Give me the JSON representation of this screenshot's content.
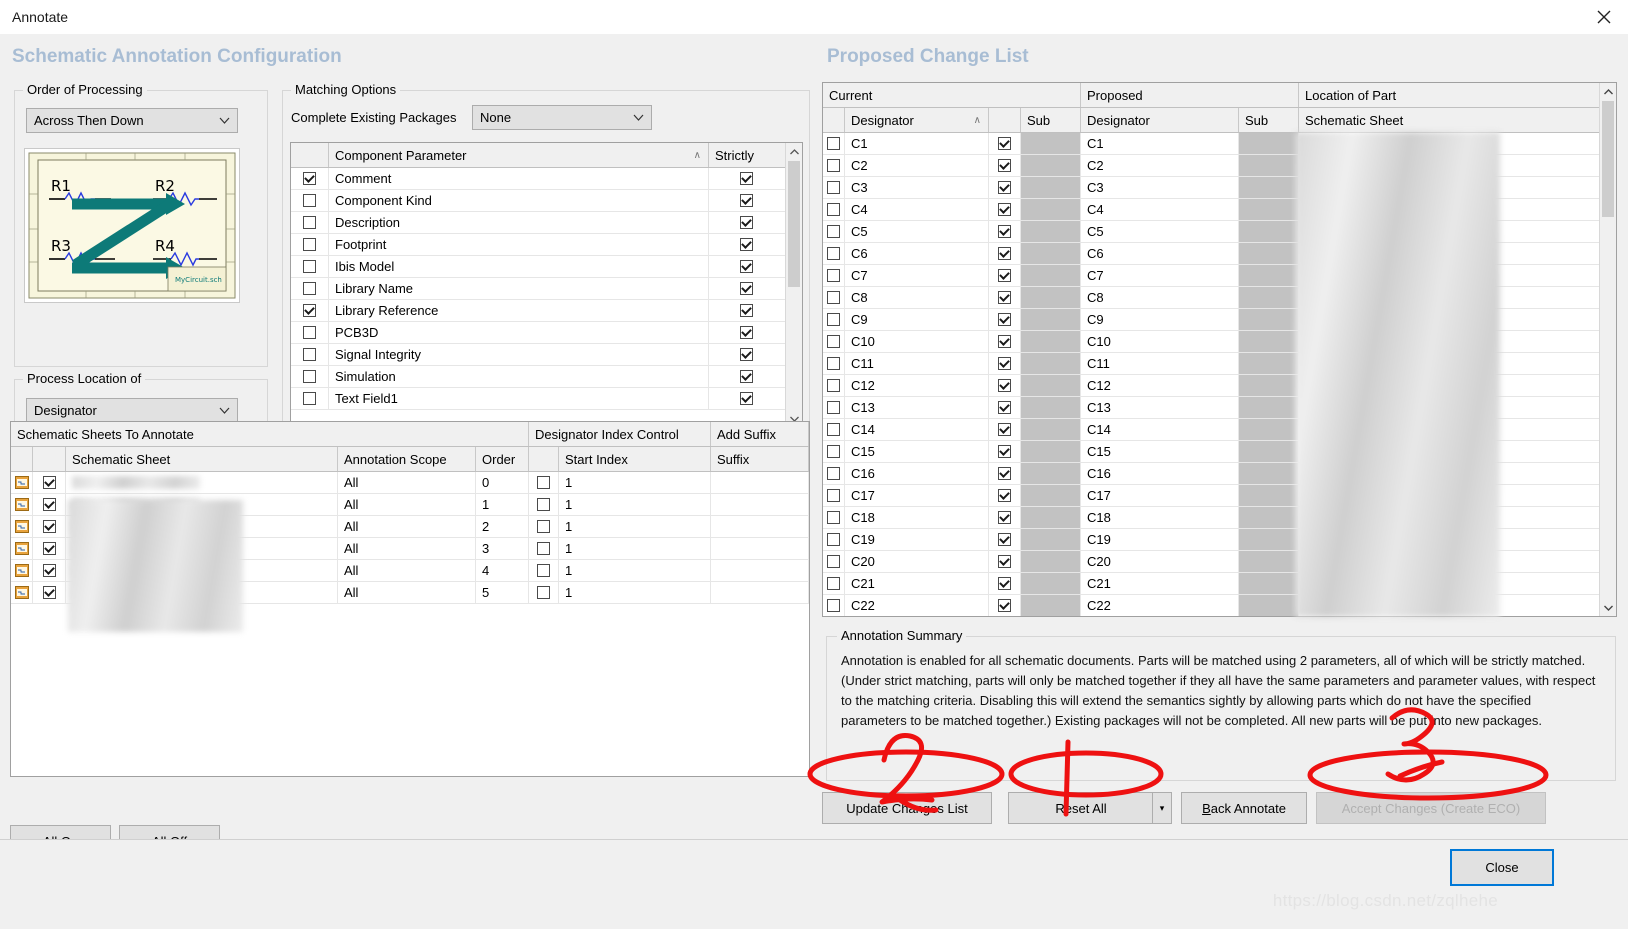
{
  "window": {
    "title": "Annotate",
    "close_icon": "close-icon"
  },
  "left": {
    "panel_title": "Schematic Annotation Configuration",
    "order_of_processing": {
      "legend": "Order of Processing",
      "value": "Across Then Down",
      "preview_labels": [
        "R1",
        "R2",
        "R3",
        "R4"
      ],
      "preview_caption": "MyCircuit.sch"
    },
    "process_location_of": {
      "legend": "Process Location of",
      "value": "Designator"
    },
    "matching_options": {
      "legend": "Matching Options",
      "complete_existing_packages_label": "Complete Existing Packages",
      "complete_existing_packages_value": "None",
      "columns": [
        "",
        "Component Parameter",
        "Strictly"
      ],
      "sort_indicator": "∧",
      "rows": [
        {
          "enabled": true,
          "parameter": "Comment",
          "strictly": true
        },
        {
          "enabled": false,
          "parameter": "Component Kind",
          "strictly": true
        },
        {
          "enabled": false,
          "parameter": "Description",
          "strictly": true
        },
        {
          "enabled": false,
          "parameter": "Footprint",
          "strictly": true
        },
        {
          "enabled": false,
          "parameter": "Ibis Model",
          "strictly": true
        },
        {
          "enabled": false,
          "parameter": "Library Name",
          "strictly": true
        },
        {
          "enabled": true,
          "parameter": "Library Reference",
          "strictly": true
        },
        {
          "enabled": false,
          "parameter": "PCB3D",
          "strictly": true
        },
        {
          "enabled": false,
          "parameter": "Signal Integrity",
          "strictly": true
        },
        {
          "enabled": false,
          "parameter": "Simulation",
          "strictly": true
        },
        {
          "enabled": false,
          "parameter": "Text Field1",
          "strictly": true
        }
      ]
    },
    "sheets_grid": {
      "group_headers": [
        "Schematic Sheets To Annotate",
        "Designator Index Control",
        "Add Suffix"
      ],
      "columns": [
        "",
        "",
        "Schematic Sheet",
        "Annotation Scope",
        "Order",
        "",
        "Start Index",
        "Suffix"
      ],
      "rows": [
        {
          "enabled": true,
          "sheet": "",
          "scope": "All",
          "order": "0",
          "index_enabled": false,
          "start_index": "1",
          "suffix": ""
        },
        {
          "enabled": true,
          "sheet": "",
          "scope": "All",
          "order": "1",
          "index_enabled": false,
          "start_index": "1",
          "suffix": ""
        },
        {
          "enabled": true,
          "sheet": "",
          "scope": "All",
          "order": "2",
          "index_enabled": false,
          "start_index": "1",
          "suffix": ""
        },
        {
          "enabled": true,
          "sheet": "",
          "scope": "All",
          "order": "3",
          "index_enabled": false,
          "start_index": "1",
          "suffix": ""
        },
        {
          "enabled": true,
          "sheet": "",
          "scope": "All",
          "order": "4",
          "index_enabled": false,
          "start_index": "1",
          "suffix": ""
        },
        {
          "enabled": true,
          "sheet": "",
          "scope": "All",
          "order": "5",
          "index_enabled": false,
          "start_index": "1",
          "suffix": ""
        }
      ]
    },
    "all_on_button": "All On",
    "all_on_mnemonic": "O",
    "all_off_button": "All Off",
    "all_off_mnemonic": "O"
  },
  "right": {
    "panel_title": "Proposed Change List",
    "group_headers": [
      "Current",
      "Proposed",
      "Location of Part"
    ],
    "columns": [
      "",
      "Designator",
      "",
      "Sub",
      "Designator",
      "Sub",
      "Schematic Sheet"
    ],
    "sort_indicator": "∧",
    "rows": [
      {
        "selected": false,
        "current": "C1",
        "accept": true,
        "current_sub": "",
        "proposed": "C1",
        "proposed_sub": "",
        "sheet": ""
      },
      {
        "selected": false,
        "current": "C2",
        "accept": true,
        "current_sub": "",
        "proposed": "C2",
        "proposed_sub": "",
        "sheet": ""
      },
      {
        "selected": false,
        "current": "C3",
        "accept": true,
        "current_sub": "",
        "proposed": "C3",
        "proposed_sub": "",
        "sheet": ""
      },
      {
        "selected": false,
        "current": "C4",
        "accept": true,
        "current_sub": "",
        "proposed": "C4",
        "proposed_sub": "",
        "sheet": ""
      },
      {
        "selected": false,
        "current": "C5",
        "accept": true,
        "current_sub": "",
        "proposed": "C5",
        "proposed_sub": "",
        "sheet": ""
      },
      {
        "selected": false,
        "current": "C6",
        "accept": true,
        "current_sub": "",
        "proposed": "C6",
        "proposed_sub": "",
        "sheet": ""
      },
      {
        "selected": false,
        "current": "C7",
        "accept": true,
        "current_sub": "",
        "proposed": "C7",
        "proposed_sub": "",
        "sheet": ""
      },
      {
        "selected": false,
        "current": "C8",
        "accept": true,
        "current_sub": "",
        "proposed": "C8",
        "proposed_sub": "",
        "sheet": ""
      },
      {
        "selected": false,
        "current": "C9",
        "accept": true,
        "current_sub": "",
        "proposed": "C9",
        "proposed_sub": "",
        "sheet": ""
      },
      {
        "selected": false,
        "current": "C10",
        "accept": true,
        "current_sub": "",
        "proposed": "C10",
        "proposed_sub": "",
        "sheet": ""
      },
      {
        "selected": false,
        "current": "C11",
        "accept": true,
        "current_sub": "",
        "proposed": "C11",
        "proposed_sub": "",
        "sheet": ""
      },
      {
        "selected": false,
        "current": "C12",
        "accept": true,
        "current_sub": "",
        "proposed": "C12",
        "proposed_sub": "",
        "sheet": ""
      },
      {
        "selected": false,
        "current": "C13",
        "accept": true,
        "current_sub": "",
        "proposed": "C13",
        "proposed_sub": "",
        "sheet": ""
      },
      {
        "selected": false,
        "current": "C14",
        "accept": true,
        "current_sub": "",
        "proposed": "C14",
        "proposed_sub": "",
        "sheet": ""
      },
      {
        "selected": false,
        "current": "C15",
        "accept": true,
        "current_sub": "",
        "proposed": "C15",
        "proposed_sub": "",
        "sheet": ""
      },
      {
        "selected": false,
        "current": "C16",
        "accept": true,
        "current_sub": "",
        "proposed": "C16",
        "proposed_sub": "",
        "sheet": ""
      },
      {
        "selected": false,
        "current": "C17",
        "accept": true,
        "current_sub": "",
        "proposed": "C17",
        "proposed_sub": "",
        "sheet": ""
      },
      {
        "selected": false,
        "current": "C18",
        "accept": true,
        "current_sub": "",
        "proposed": "C18",
        "proposed_sub": "",
        "sheet": ""
      },
      {
        "selected": false,
        "current": "C19",
        "accept": true,
        "current_sub": "",
        "proposed": "C19",
        "proposed_sub": "",
        "sheet": ""
      },
      {
        "selected": false,
        "current": "C20",
        "accept": true,
        "current_sub": "",
        "proposed": "C20",
        "proposed_sub": "",
        "sheet": ""
      },
      {
        "selected": false,
        "current": "C21",
        "accept": true,
        "current_sub": "",
        "proposed": "C21",
        "proposed_sub": "",
        "sheet": ""
      },
      {
        "selected": false,
        "current": "C22",
        "accept": true,
        "current_sub": "",
        "proposed": "C22",
        "proposed_sub": "",
        "sheet": ""
      }
    ],
    "summary": {
      "legend": "Annotation Summary",
      "text": "Annotation is enabled for all schematic documents. Parts will be matched using 2 parameters, all of which will be strictly matched. (Under strict matching, parts will only be matched together if they all have the same parameters and parameter values, with respect to the matching criteria. Disabling this will extend the semantics sightly by allowing parts which do not have the specified parameters to be matched together.) Existing packages will not be completed. All new parts will be put into new packages."
    },
    "buttons": {
      "update_changes_list": "Update Changes List",
      "reset_all": "Reset All",
      "reset_all_dropdown": "▾",
      "back_annotate": "Back Annotate",
      "back_annotate_mnemonic": "B",
      "accept_changes": "Accept Changes (Create ECO)",
      "close": "Close"
    }
  },
  "ink_annotations": [
    {
      "label": "2",
      "target": "update-changes-list-button"
    },
    {
      "label": "1",
      "target": "reset-all-button"
    },
    {
      "label": "3",
      "target": "accept-changes-button"
    }
  ],
  "watermark": "https://blog.csdn.net/zqlhehe"
}
